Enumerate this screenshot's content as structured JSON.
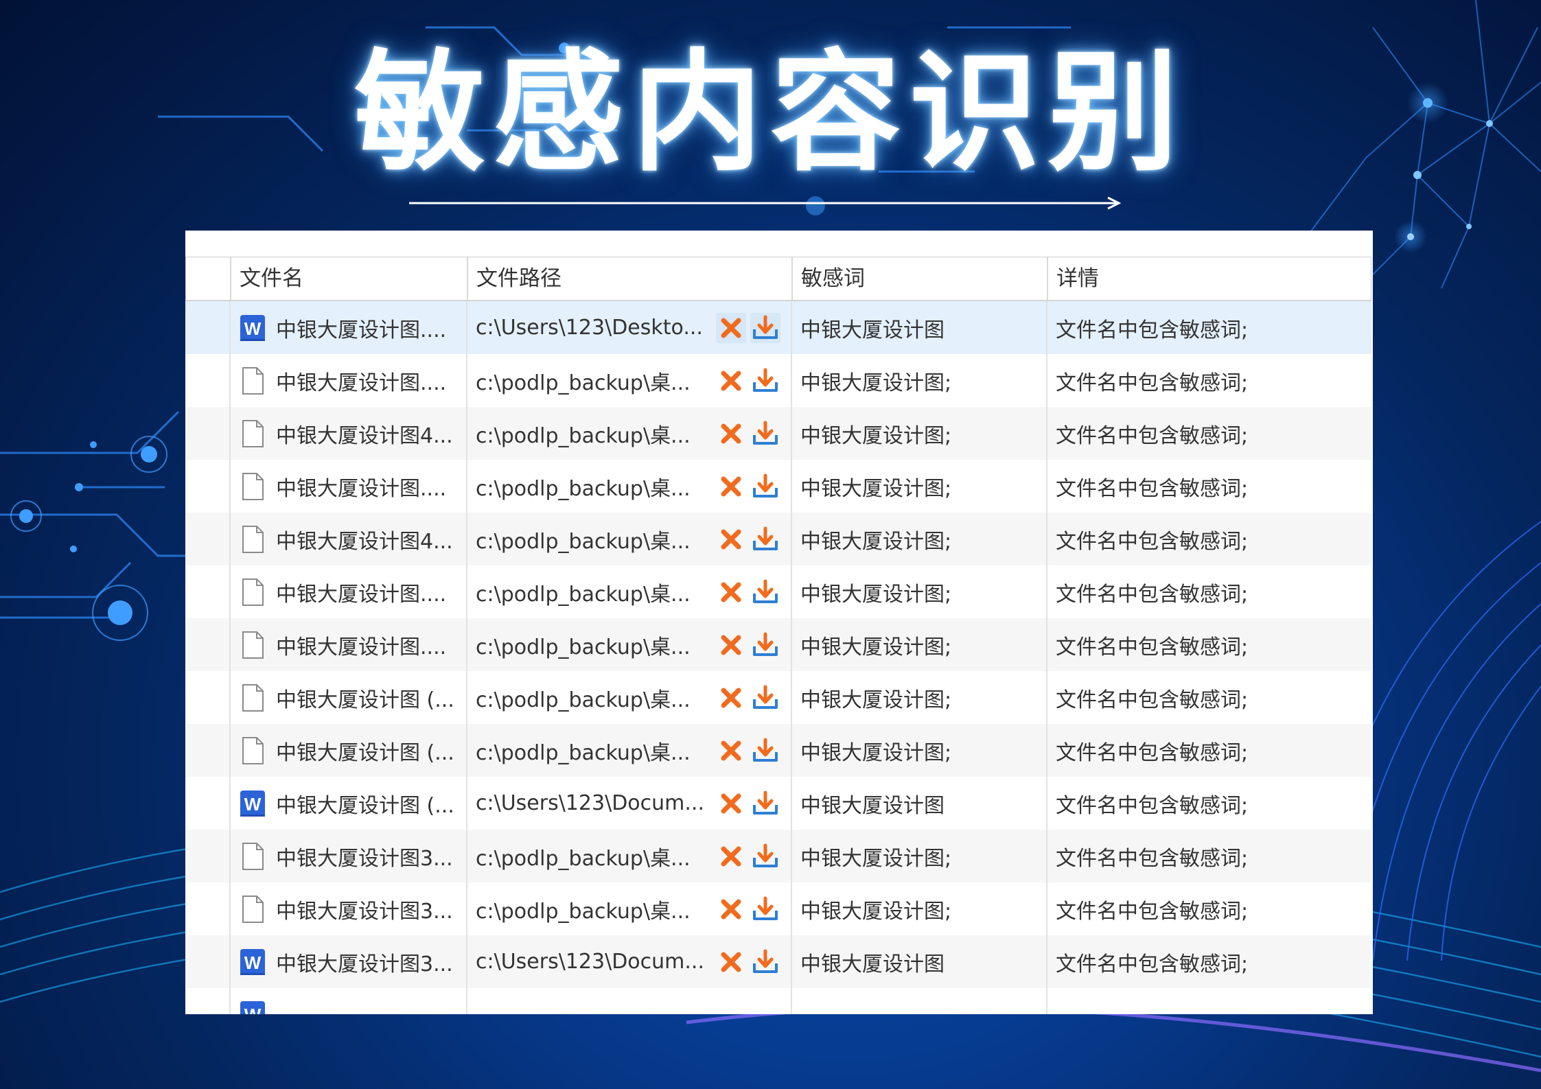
{
  "banner": {
    "title": "敏感内容识别"
  },
  "table": {
    "columns": [
      "",
      "文件名",
      "文件路径",
      "敏感词",
      "详情"
    ],
    "rows": [
      {
        "icon": "word-file-icon",
        "filename": "中银大厦设计图....",
        "path": "c:\\Users\\123\\Deskto...",
        "keyword": "中银大厦设计图",
        "detail": "文件名中包含敏感词;",
        "selected": true
      },
      {
        "icon": "blank-file-icon",
        "filename": "中银大厦设计图....",
        "path": "c:\\podlp_backup\\桌...",
        "keyword": "中银大厦设计图;",
        "detail": "文件名中包含敏感词;",
        "selected": false
      },
      {
        "icon": "blank-file-icon",
        "filename": "中银大厦设计图4...",
        "path": "c:\\podlp_backup\\桌...",
        "keyword": "中银大厦设计图;",
        "detail": "文件名中包含敏感词;",
        "selected": false
      },
      {
        "icon": "blank-file-icon",
        "filename": "中银大厦设计图....",
        "path": "c:\\podlp_backup\\桌...",
        "keyword": "中银大厦设计图;",
        "detail": "文件名中包含敏感词;",
        "selected": false
      },
      {
        "icon": "blank-file-icon",
        "filename": "中银大厦设计图4...",
        "path": "c:\\podlp_backup\\桌...",
        "keyword": "中银大厦设计图;",
        "detail": "文件名中包含敏感词;",
        "selected": false
      },
      {
        "icon": "blank-file-icon",
        "filename": "中银大厦设计图....",
        "path": "c:\\podlp_backup\\桌...",
        "keyword": "中银大厦设计图;",
        "detail": "文件名中包含敏感词;",
        "selected": false
      },
      {
        "icon": "blank-file-icon",
        "filename": "中银大厦设计图....",
        "path": "c:\\podlp_backup\\桌...",
        "keyword": "中银大厦设计图;",
        "detail": "文件名中包含敏感词;",
        "selected": false
      },
      {
        "icon": "blank-file-icon",
        "filename": "中银大厦设计图 (...",
        "path": "c:\\podlp_backup\\桌...",
        "keyword": "中银大厦设计图;",
        "detail": "文件名中包含敏感词;",
        "selected": false
      },
      {
        "icon": "blank-file-icon",
        "filename": "中银大厦设计图 (...",
        "path": "c:\\podlp_backup\\桌...",
        "keyword": "中银大厦设计图;",
        "detail": "文件名中包含敏感词;",
        "selected": false
      },
      {
        "icon": "word-file-icon",
        "filename": "中银大厦设计图 (...",
        "path": "c:\\Users\\123\\Docum...",
        "keyword": "中银大厦设计图",
        "detail": "文件名中包含敏感词;",
        "selected": false
      },
      {
        "icon": "blank-file-icon",
        "filename": "中银大厦设计图3...",
        "path": "c:\\podlp_backup\\桌...",
        "keyword": "中银大厦设计图;",
        "detail": "文件名中包含敏感词;",
        "selected": false
      },
      {
        "icon": "blank-file-icon",
        "filename": "中银大厦设计图3...",
        "path": "c:\\podlp_backup\\桌...",
        "keyword": "中银大厦设计图;",
        "detail": "文件名中包含敏感词;",
        "selected": false
      },
      {
        "icon": "word-file-icon",
        "filename": "中银大厦设计图3...",
        "path": "c:\\Users\\123\\Docum...",
        "keyword": "中银大厦设计图",
        "detail": "文件名中包含敏感词;",
        "selected": false
      }
    ]
  },
  "colors": {
    "delete_icon": "#f26b1d",
    "download_icon": "#2d7fd3",
    "word_icon": "#2b63d8",
    "selected_row": "#e4f0fb"
  }
}
